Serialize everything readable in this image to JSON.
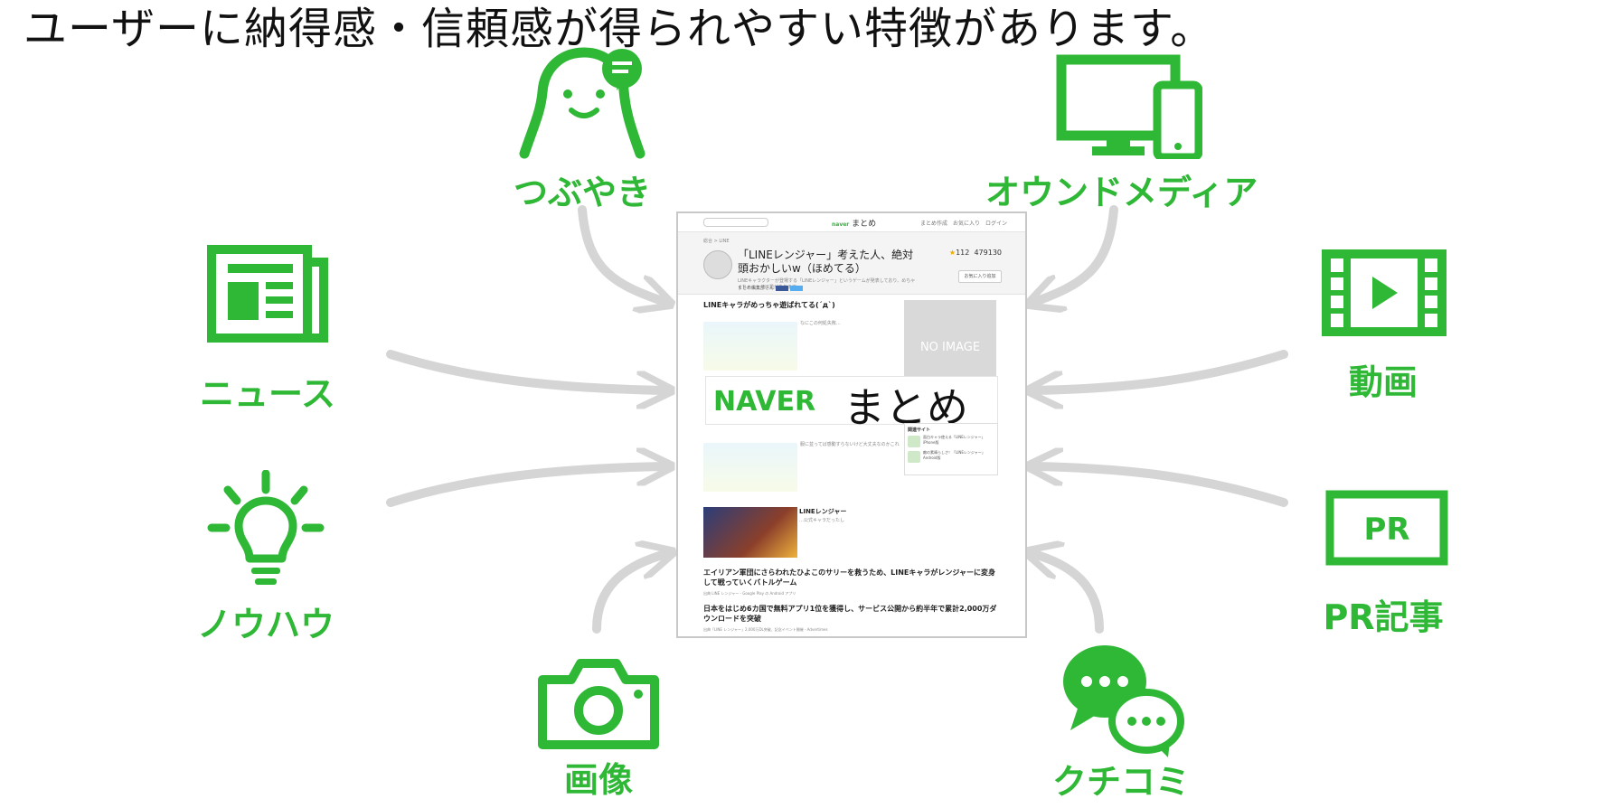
{
  "headline": "ユーザーに納得感・信頼感が得られやすい特徴があります。",
  "colors": {
    "accent": "#2fb736",
    "arrow": "#d5d5d5"
  },
  "sources": [
    {
      "id": "tsubuyaki",
      "label": "つぶやき",
      "icon": "speech-person-icon"
    },
    {
      "id": "owned-media",
      "label": "オウンドメディア",
      "icon": "devices-icon"
    },
    {
      "id": "news",
      "label": "ニュース",
      "icon": "newspaper-icon"
    },
    {
      "id": "video",
      "label": "動画",
      "icon": "film-play-icon"
    },
    {
      "id": "knowhow",
      "label": "ノウハウ",
      "icon": "lightbulb-icon"
    },
    {
      "id": "pr",
      "label": "PR記事",
      "icon": "pr-badge-icon",
      "badge_text": "PR"
    },
    {
      "id": "image",
      "label": "画像",
      "icon": "camera-icon"
    },
    {
      "id": "kuchikomi",
      "label": "クチコミ",
      "icon": "chat-bubbles-icon"
    }
  ],
  "screenshot": {
    "logo_small": "naver",
    "logo_text": "まとめ",
    "nav": "まとめ作成　お気に入り　ログイン",
    "breadcrumb": "総合 > LINE",
    "title": "「LINEレンジャー」考えた人、絶対頭おかしいw（ほめてる）",
    "subtitle": "LINEキャラクターが登場する「LINEレンジャー」というゲームが発表しており、めちゃくちゃキャラに愛があります",
    "stars": "112",
    "views": "479130",
    "fav_button": "お気に入り追加",
    "share_author": "まとめ編集部さん",
    "section_title": "LINEキャラがめっちゃ遊ばれてる(´д`)",
    "caption1": "なにこの何処失敗…",
    "caption2": "服に並ってば感動すらないけど大丈夫なのかこれ",
    "no_image": "NO IMAGE",
    "naver_brand": "NAVER",
    "naver_matome": "まとめ",
    "related_title": "関連サイト",
    "related": [
      {
        "title": "面白キャラ使える「LINEレンジャー」iPhone版"
      },
      {
        "title": "敵の素晴らしさ！「LINEレンジャー」Android版"
      }
    ],
    "game_title": "LINEレンジャー",
    "game_sub": "…公式キャラだったし",
    "news": [
      {
        "title": "エイリアン軍団にさらわれたひよこのサリーを救うため、LINEキャラがレンジャーに変身して戦っていくバトルゲーム",
        "source": "出典 LINE レンジャー - Google Play の Android アプリ"
      },
      {
        "title": "日本をはじめ6カ国で無料アプリ1位を獲得し、サービス公開から約半年で累計2,000万ダウンロードを突破",
        "source": "出典「LINE レンジャー」2,000万DL突破、記念イベント開催 - Advertimes"
      }
    ]
  }
}
